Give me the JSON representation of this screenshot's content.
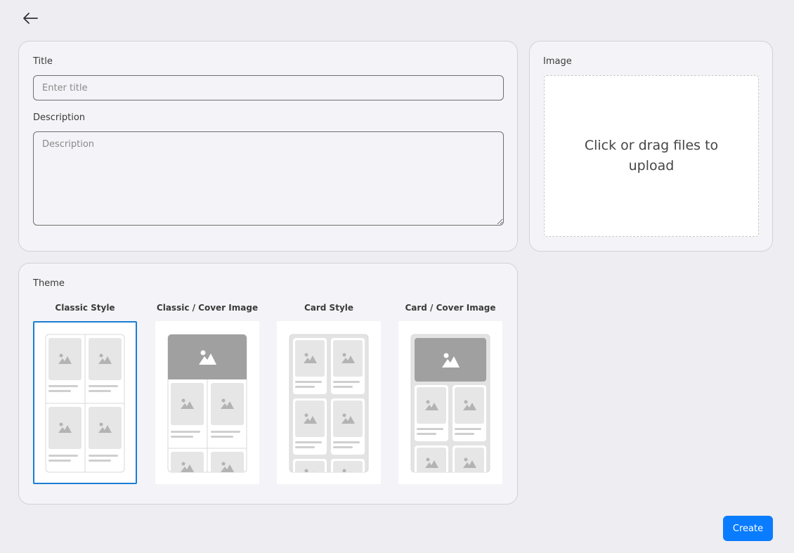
{
  "header": {
    "back_icon": "arrow-left-icon"
  },
  "form": {
    "title_label": "Title",
    "title_placeholder": "Enter title",
    "title_value": "",
    "description_label": "Description",
    "description_placeholder": "Description",
    "description_value": ""
  },
  "image": {
    "label": "Image",
    "upload_text": "Click or drag files to upload"
  },
  "theme": {
    "label": "Theme",
    "selected": "Classic Style",
    "options": [
      {
        "name": "Classic Style"
      },
      {
        "name": "Classic / Cover Image"
      },
      {
        "name": "Card Style"
      },
      {
        "name": "Card / Cover Image"
      }
    ]
  },
  "actions": {
    "create_label": "Create"
  },
  "colors": {
    "accent": "#0a7cff",
    "selected_border": "#1a7ed3",
    "background": "#eeedf1",
    "panel": "#f4f3f7"
  }
}
